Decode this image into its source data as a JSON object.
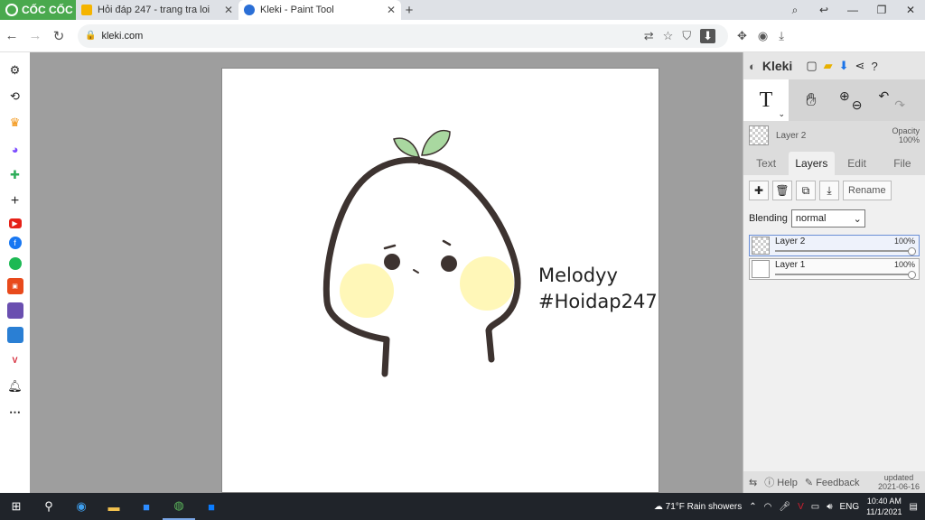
{
  "browser": {
    "logo_text": "CỐC CỐC",
    "tabs": [
      {
        "title": "Hỏi đáp 247 - trang tra loi",
        "active": false
      },
      {
        "title": "Kleki - Paint Tool",
        "active": true
      }
    ],
    "new_tab": "+",
    "url": "kleki.com"
  },
  "canvas_text": {
    "line1": "Melodyy",
    "line2": "#Hoidap247"
  },
  "panel": {
    "brand": "Kleki",
    "tool_t": "T",
    "layer_name": "Layer 2",
    "opacity_label": "Opacity",
    "opacity_value": "100%",
    "tabs": [
      "Text",
      "Layers",
      "Edit",
      "File"
    ],
    "rename": "Rename",
    "blending_label": "Blending",
    "blending_value": "normal",
    "layers": [
      {
        "name": "Layer 2",
        "opacity": "100%"
      },
      {
        "name": "Layer 1",
        "opacity": "100%"
      }
    ],
    "help": "Help",
    "feedback": "Feedback",
    "updated_label": "updated",
    "updated_date": "2021-06-16"
  },
  "taskbar": {
    "weather": "71°F  Rain showers",
    "lang": "ENG",
    "time": "10:40 AM",
    "date": "11/1/2021"
  },
  "colors": {
    "browser_green": "#4aa94e",
    "face_outline": "#3d3330",
    "blush": "#fff7b8",
    "sprout": "#a9d8a0",
    "workspace": "#9e9e9e"
  }
}
